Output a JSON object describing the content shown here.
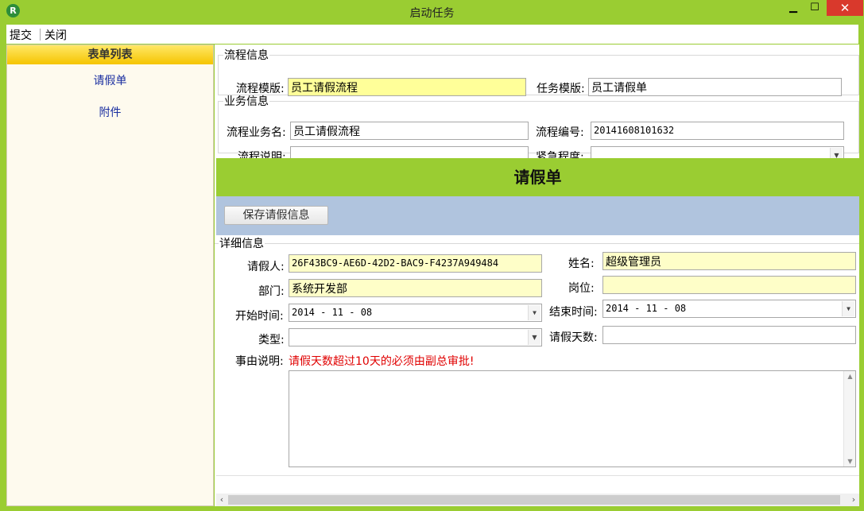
{
  "window": {
    "title": "启动任务",
    "app_icon_letter": "R",
    "minimize": "▁",
    "maximize": "☐",
    "close": "✕"
  },
  "menu": {
    "submit": "提交",
    "close": "关闭"
  },
  "left_panel": {
    "header": "表单列表",
    "items": [
      "请假单",
      "附件"
    ]
  },
  "process_info": {
    "legend": "流程信息",
    "template_label": "流程模版:",
    "template_value": "员工请假流程",
    "task_template_label": "任务模版:",
    "task_template_value": "员工请假单"
  },
  "business_info": {
    "legend": "业务信息",
    "business_name_label": "流程业务名:",
    "business_name_value": "员工请假流程",
    "number_label": "流程编号:",
    "number_value": "20141608101632",
    "description_label": "流程说明:",
    "description_value": "",
    "urgency_label": "紧急程度:",
    "urgency_value": ""
  },
  "form": {
    "title": "请假单",
    "save_button": "保存请假信息",
    "detail_legend": "详细信息",
    "applicant_label": "请假人:",
    "applicant_value": "26F43BC9-AE6D-42D2-BAC9-F4237A949484",
    "name_label": "姓名:",
    "name_value": "超级管理员",
    "department_label": "部门:",
    "department_value": "系统开发部",
    "position_label": "岗位:",
    "position_value": "",
    "start_label": "开始时间:",
    "start_value": "2014 - 11 - 08",
    "end_label": "结束时间:",
    "end_value": "2014 - 11 - 08",
    "type_label": "类型:",
    "type_value": "",
    "days_label": "请假天数:",
    "days_value": "",
    "reason_label": "事由说明:",
    "reason_warning": "请假天数超过10天的必须由副总审批!",
    "reason_value": ""
  },
  "colors": {
    "accent_green": "#9acd32",
    "band_blue": "#b0c4de",
    "warning_red": "#e00000",
    "highlight_yellow": "#ffff99"
  }
}
